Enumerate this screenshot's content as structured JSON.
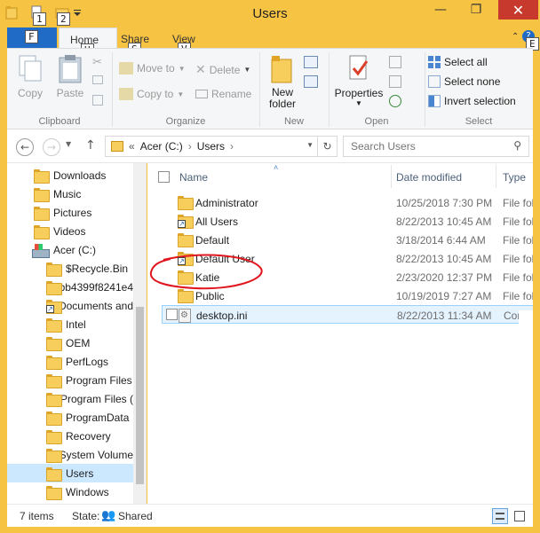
{
  "title": "Users",
  "keytips": {
    "qat1": "1",
    "qat2": "2",
    "file": "F",
    "home": "H",
    "share": "S",
    "view": "V",
    "help": "E"
  },
  "tabs": {
    "file": "File",
    "home": "Home",
    "share": "Share",
    "view": "View"
  },
  "ribbon": {
    "clipboard": {
      "label": "Clipboard",
      "copy": "Copy",
      "paste": "Paste"
    },
    "organize": {
      "label": "Organize",
      "move_to": "Move to",
      "copy_to": "Copy to",
      "delete": "Delete",
      "rename": "Rename"
    },
    "new": {
      "label": "New",
      "new_folder_line1": "New",
      "new_folder_line2": "folder"
    },
    "open": {
      "label": "Open",
      "properties": "Properties"
    },
    "select": {
      "label": "Select",
      "select_all": "Select all",
      "select_none": "Select none",
      "invert": "Invert selection"
    }
  },
  "address": {
    "prefix": "«",
    "drive": "Acer (C:)",
    "sep": "›",
    "folder": "Users"
  },
  "search": {
    "placeholder": "Search Users"
  },
  "nav": [
    {
      "label": "Downloads",
      "icon": "download-folder-icon"
    },
    {
      "label": "Music",
      "icon": "music-folder-icon"
    },
    {
      "label": "Pictures",
      "icon": "pictures-folder-icon"
    },
    {
      "label": "Videos",
      "icon": "videos-folder-icon"
    },
    {
      "label": "Acer (C:)",
      "icon": "drive-icon"
    },
    {
      "label": "$Recycle.Bin",
      "icon": "folder-icon"
    },
    {
      "label": "bb4399f8241e4",
      "icon": "folder-icon"
    },
    {
      "label": "Documents and",
      "icon": "shortcut-folder-icon"
    },
    {
      "label": "Intel",
      "icon": "folder-icon"
    },
    {
      "label": "OEM",
      "icon": "folder-icon"
    },
    {
      "label": "PerfLogs",
      "icon": "folder-icon"
    },
    {
      "label": "Program Files",
      "icon": "folder-icon"
    },
    {
      "label": "Program Files (",
      "icon": "folder-icon"
    },
    {
      "label": "ProgramData",
      "icon": "folder-icon"
    },
    {
      "label": "Recovery",
      "icon": "folder-icon"
    },
    {
      "label": "System Volume",
      "icon": "folder-icon"
    },
    {
      "label": "Users",
      "icon": "folder-icon"
    },
    {
      "label": "Windows",
      "icon": "folder-icon"
    }
  ],
  "columns": {
    "name": "Name",
    "date": "Date modified",
    "type": "Type"
  },
  "files": [
    {
      "name": "Administrator",
      "date": "10/25/2018 7:30 PM",
      "type": "File fol"
    },
    {
      "name": "All Users",
      "date": "8/22/2013 10:45 AM",
      "type": "File fol"
    },
    {
      "name": "Default",
      "date": "3/18/2014 6:44 AM",
      "type": "File fol"
    },
    {
      "name": "Default User",
      "date": "8/22/2013 10:45 AM",
      "type": "File fol"
    },
    {
      "name": "Katie",
      "date": "2/23/2020 12:37 PM",
      "type": "File fol"
    },
    {
      "name": "Public",
      "date": "10/19/2019 7:27 AM",
      "type": "File fol"
    },
    {
      "name": "desktop.ini",
      "date": "8/22/2013 11:34 AM",
      "type": "Config"
    }
  ],
  "status": {
    "items": "7 items",
    "state_label": "State:",
    "state_value": "Shared"
  },
  "colors": {
    "accent": "#1f6bc6",
    "titlebar": "#f6c343",
    "annotation": "#e0161e",
    "selection": "#cce8ff"
  }
}
